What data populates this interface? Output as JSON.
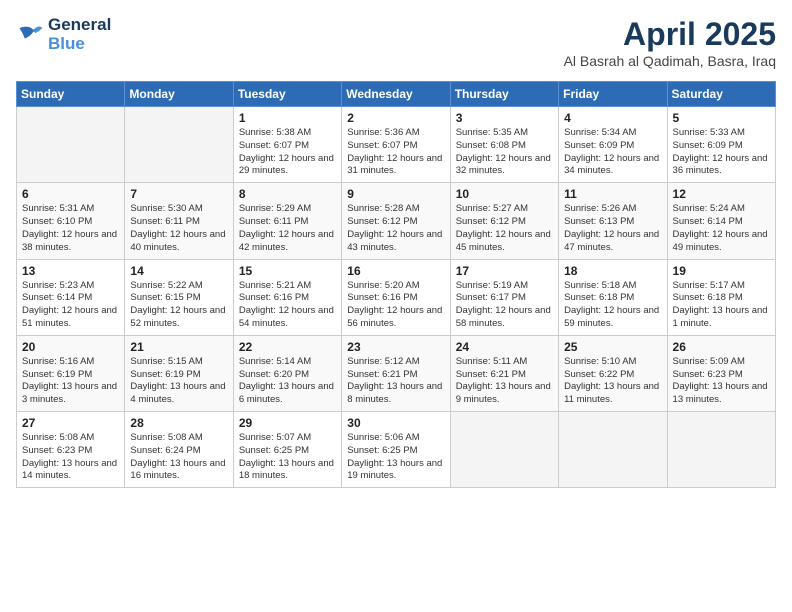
{
  "header": {
    "logo_line1": "General",
    "logo_line2": "Blue",
    "title": "April 2025",
    "location": "Al Basrah al Qadimah, Basra, Iraq"
  },
  "days_of_week": [
    "Sunday",
    "Monday",
    "Tuesday",
    "Wednesday",
    "Thursday",
    "Friday",
    "Saturday"
  ],
  "weeks": [
    [
      {
        "day": "",
        "empty": true
      },
      {
        "day": "",
        "empty": true
      },
      {
        "day": "1",
        "sunrise": "5:38 AM",
        "sunset": "6:07 PM",
        "daylight": "12 hours and 29 minutes."
      },
      {
        "day": "2",
        "sunrise": "5:36 AM",
        "sunset": "6:07 PM",
        "daylight": "12 hours and 31 minutes."
      },
      {
        "day": "3",
        "sunrise": "5:35 AM",
        "sunset": "6:08 PM",
        "daylight": "12 hours and 32 minutes."
      },
      {
        "day": "4",
        "sunrise": "5:34 AM",
        "sunset": "6:09 PM",
        "daylight": "12 hours and 34 minutes."
      },
      {
        "day": "5",
        "sunrise": "5:33 AM",
        "sunset": "6:09 PM",
        "daylight": "12 hours and 36 minutes."
      }
    ],
    [
      {
        "day": "6",
        "sunrise": "5:31 AM",
        "sunset": "6:10 PM",
        "daylight": "12 hours and 38 minutes."
      },
      {
        "day": "7",
        "sunrise": "5:30 AM",
        "sunset": "6:11 PM",
        "daylight": "12 hours and 40 minutes."
      },
      {
        "day": "8",
        "sunrise": "5:29 AM",
        "sunset": "6:11 PM",
        "daylight": "12 hours and 42 minutes."
      },
      {
        "day": "9",
        "sunrise": "5:28 AM",
        "sunset": "6:12 PM",
        "daylight": "12 hours and 43 minutes."
      },
      {
        "day": "10",
        "sunrise": "5:27 AM",
        "sunset": "6:12 PM",
        "daylight": "12 hours and 45 minutes."
      },
      {
        "day": "11",
        "sunrise": "5:26 AM",
        "sunset": "6:13 PM",
        "daylight": "12 hours and 47 minutes."
      },
      {
        "day": "12",
        "sunrise": "5:24 AM",
        "sunset": "6:14 PM",
        "daylight": "12 hours and 49 minutes."
      }
    ],
    [
      {
        "day": "13",
        "sunrise": "5:23 AM",
        "sunset": "6:14 PM",
        "daylight": "12 hours and 51 minutes."
      },
      {
        "day": "14",
        "sunrise": "5:22 AM",
        "sunset": "6:15 PM",
        "daylight": "12 hours and 52 minutes."
      },
      {
        "day": "15",
        "sunrise": "5:21 AM",
        "sunset": "6:16 PM",
        "daylight": "12 hours and 54 minutes."
      },
      {
        "day": "16",
        "sunrise": "5:20 AM",
        "sunset": "6:16 PM",
        "daylight": "12 hours and 56 minutes."
      },
      {
        "day": "17",
        "sunrise": "5:19 AM",
        "sunset": "6:17 PM",
        "daylight": "12 hours and 58 minutes."
      },
      {
        "day": "18",
        "sunrise": "5:18 AM",
        "sunset": "6:18 PM",
        "daylight": "12 hours and 59 minutes."
      },
      {
        "day": "19",
        "sunrise": "5:17 AM",
        "sunset": "6:18 PM",
        "daylight": "13 hours and 1 minute."
      }
    ],
    [
      {
        "day": "20",
        "sunrise": "5:16 AM",
        "sunset": "6:19 PM",
        "daylight": "13 hours and 3 minutes."
      },
      {
        "day": "21",
        "sunrise": "5:15 AM",
        "sunset": "6:19 PM",
        "daylight": "13 hours and 4 minutes."
      },
      {
        "day": "22",
        "sunrise": "5:14 AM",
        "sunset": "6:20 PM",
        "daylight": "13 hours and 6 minutes."
      },
      {
        "day": "23",
        "sunrise": "5:12 AM",
        "sunset": "6:21 PM",
        "daylight": "13 hours and 8 minutes."
      },
      {
        "day": "24",
        "sunrise": "5:11 AM",
        "sunset": "6:21 PM",
        "daylight": "13 hours and 9 minutes."
      },
      {
        "day": "25",
        "sunrise": "5:10 AM",
        "sunset": "6:22 PM",
        "daylight": "13 hours and 11 minutes."
      },
      {
        "day": "26",
        "sunrise": "5:09 AM",
        "sunset": "6:23 PM",
        "daylight": "13 hours and 13 minutes."
      }
    ],
    [
      {
        "day": "27",
        "sunrise": "5:08 AM",
        "sunset": "6:23 PM",
        "daylight": "13 hours and 14 minutes."
      },
      {
        "day": "28",
        "sunrise": "5:08 AM",
        "sunset": "6:24 PM",
        "daylight": "13 hours and 16 minutes."
      },
      {
        "day": "29",
        "sunrise": "5:07 AM",
        "sunset": "6:25 PM",
        "daylight": "13 hours and 18 minutes."
      },
      {
        "day": "30",
        "sunrise": "5:06 AM",
        "sunset": "6:25 PM",
        "daylight": "13 hours and 19 minutes."
      },
      {
        "day": "",
        "empty": true
      },
      {
        "day": "",
        "empty": true
      },
      {
        "day": "",
        "empty": true
      }
    ]
  ],
  "labels": {
    "sunrise": "Sunrise:",
    "sunset": "Sunset:",
    "daylight": "Daylight:"
  }
}
